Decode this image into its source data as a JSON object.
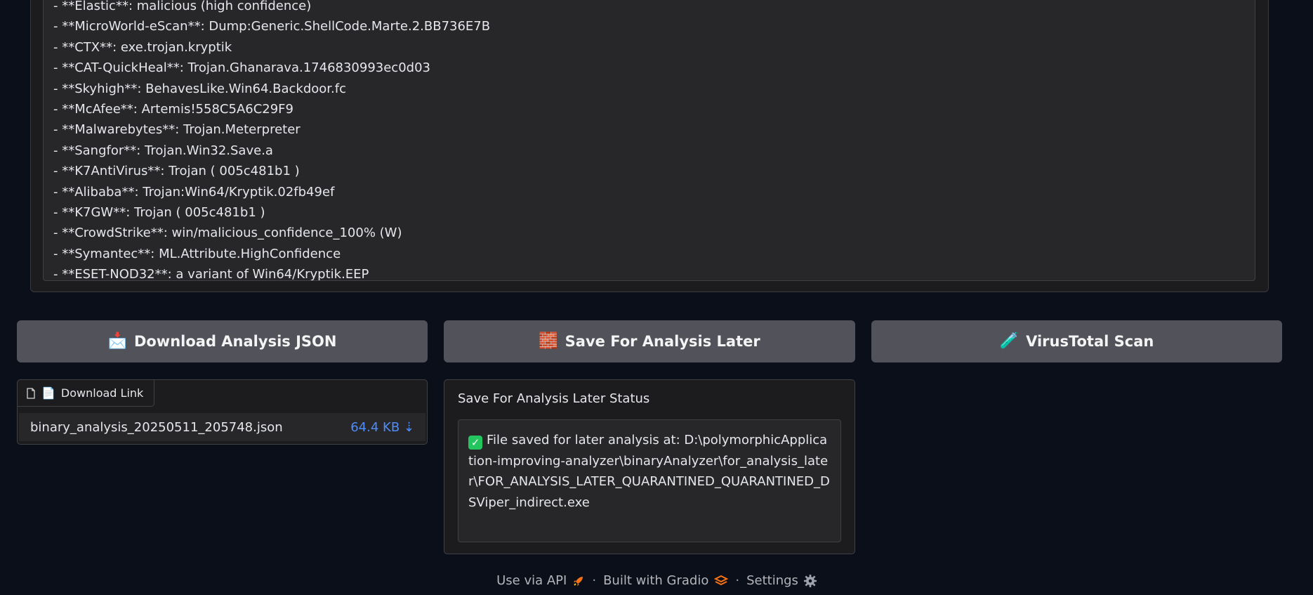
{
  "av_results": [
    "- **Elastic**: malicious (high confidence)",
    "- **MicroWorld-eScan**: Dump:Generic.ShellCode.Marte.2.BB736E7B",
    "- **CTX**: exe.trojan.kryptik",
    "- **CAT-QuickHeal**: Trojan.Ghanarava.1746830993ec0d03",
    "- **Skyhigh**: BehavesLike.Win64.Backdoor.fc",
    "- **McAfee**: Artemis!558C5A6C29F9",
    "- **Malwarebytes**: Trojan.Meterpreter",
    "- **Sangfor**: Trojan.Win32.Save.a",
    "- **K7AntiVirus**: Trojan ( 005c481b1 )",
    "- **Alibaba**: Trojan:Win64/Kryptik.02fb49ef",
    "- **K7GW**: Trojan ( 005c481b1 )",
    "- **CrowdStrike**: win/malicious_confidence_100% (W)",
    "- **Symantec**: ML.Attribute.HighConfidence",
    "- **ESET-NOD32**: a variant of Win64/Kryptik.EEP"
  ],
  "buttons": {
    "download_json": {
      "icon": "📩",
      "label": "Download Analysis JSON"
    },
    "save_later": {
      "icon": "🧱",
      "label": "Save For Analysis Later"
    },
    "virustotal": {
      "icon": "🧪",
      "label": "VirusTotal Scan"
    }
  },
  "download": {
    "label_icon": "📄",
    "label": "Download Link",
    "filename": "binary_analysis_20250511_205748.json",
    "size": "64.4 KB ⇣"
  },
  "save_status": {
    "title": "Save For Analysis Later Status",
    "check": "✓",
    "message": "File saved for later analysis at: D:\\polymorphicApplication-improving-analyzer\\binaryAnalyzer\\for_analysis_later\\FOR_ANALYSIS_LATER_QUARANTINED_QUARANTINED_DSViper_indirect.exe"
  },
  "footer": {
    "api": "Use via API",
    "gradio": "Built with Gradio",
    "settings": "Settings",
    "separator": "·"
  },
  "colors": {
    "background": "#0b0f19",
    "button": "#52525b",
    "link": "#4f8cf5",
    "success": "#22c55e",
    "gradio_orange": "#f97316"
  }
}
